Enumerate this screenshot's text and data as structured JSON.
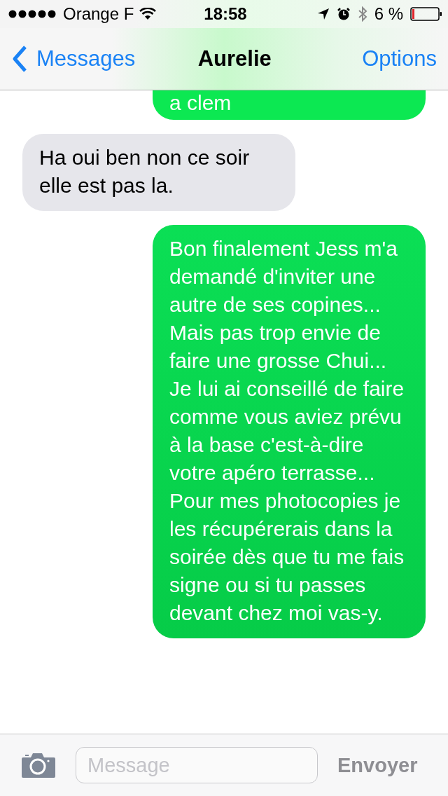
{
  "status_bar": {
    "carrier": "Orange F",
    "time": "18:58",
    "battery": "6 %"
  },
  "nav": {
    "back": "Messages",
    "title": "Aurelie",
    "action": "Options"
  },
  "messages": [
    {
      "kind": "sent",
      "text": "a clem",
      "cut": true
    },
    {
      "kind": "received",
      "text": "Ha oui ben non ce soir elle est pas la.",
      "cut": false
    },
    {
      "kind": "sent",
      "text": "Bon finalement Jess m'a demandé d'inviter une autre de ses copines... Mais pas trop envie de faire une grosse Chui... Je lui ai conseillé de faire comme vous aviez prévu à la base c'est-à-dire votre apéro terrasse... Pour mes photocopies je les récupérerais dans la soirée dès que tu me fais signe ou si tu passes devant chez moi vas-y.",
      "cut": false
    }
  ],
  "composer": {
    "placeholder": "Message",
    "send": "Envoyer"
  }
}
